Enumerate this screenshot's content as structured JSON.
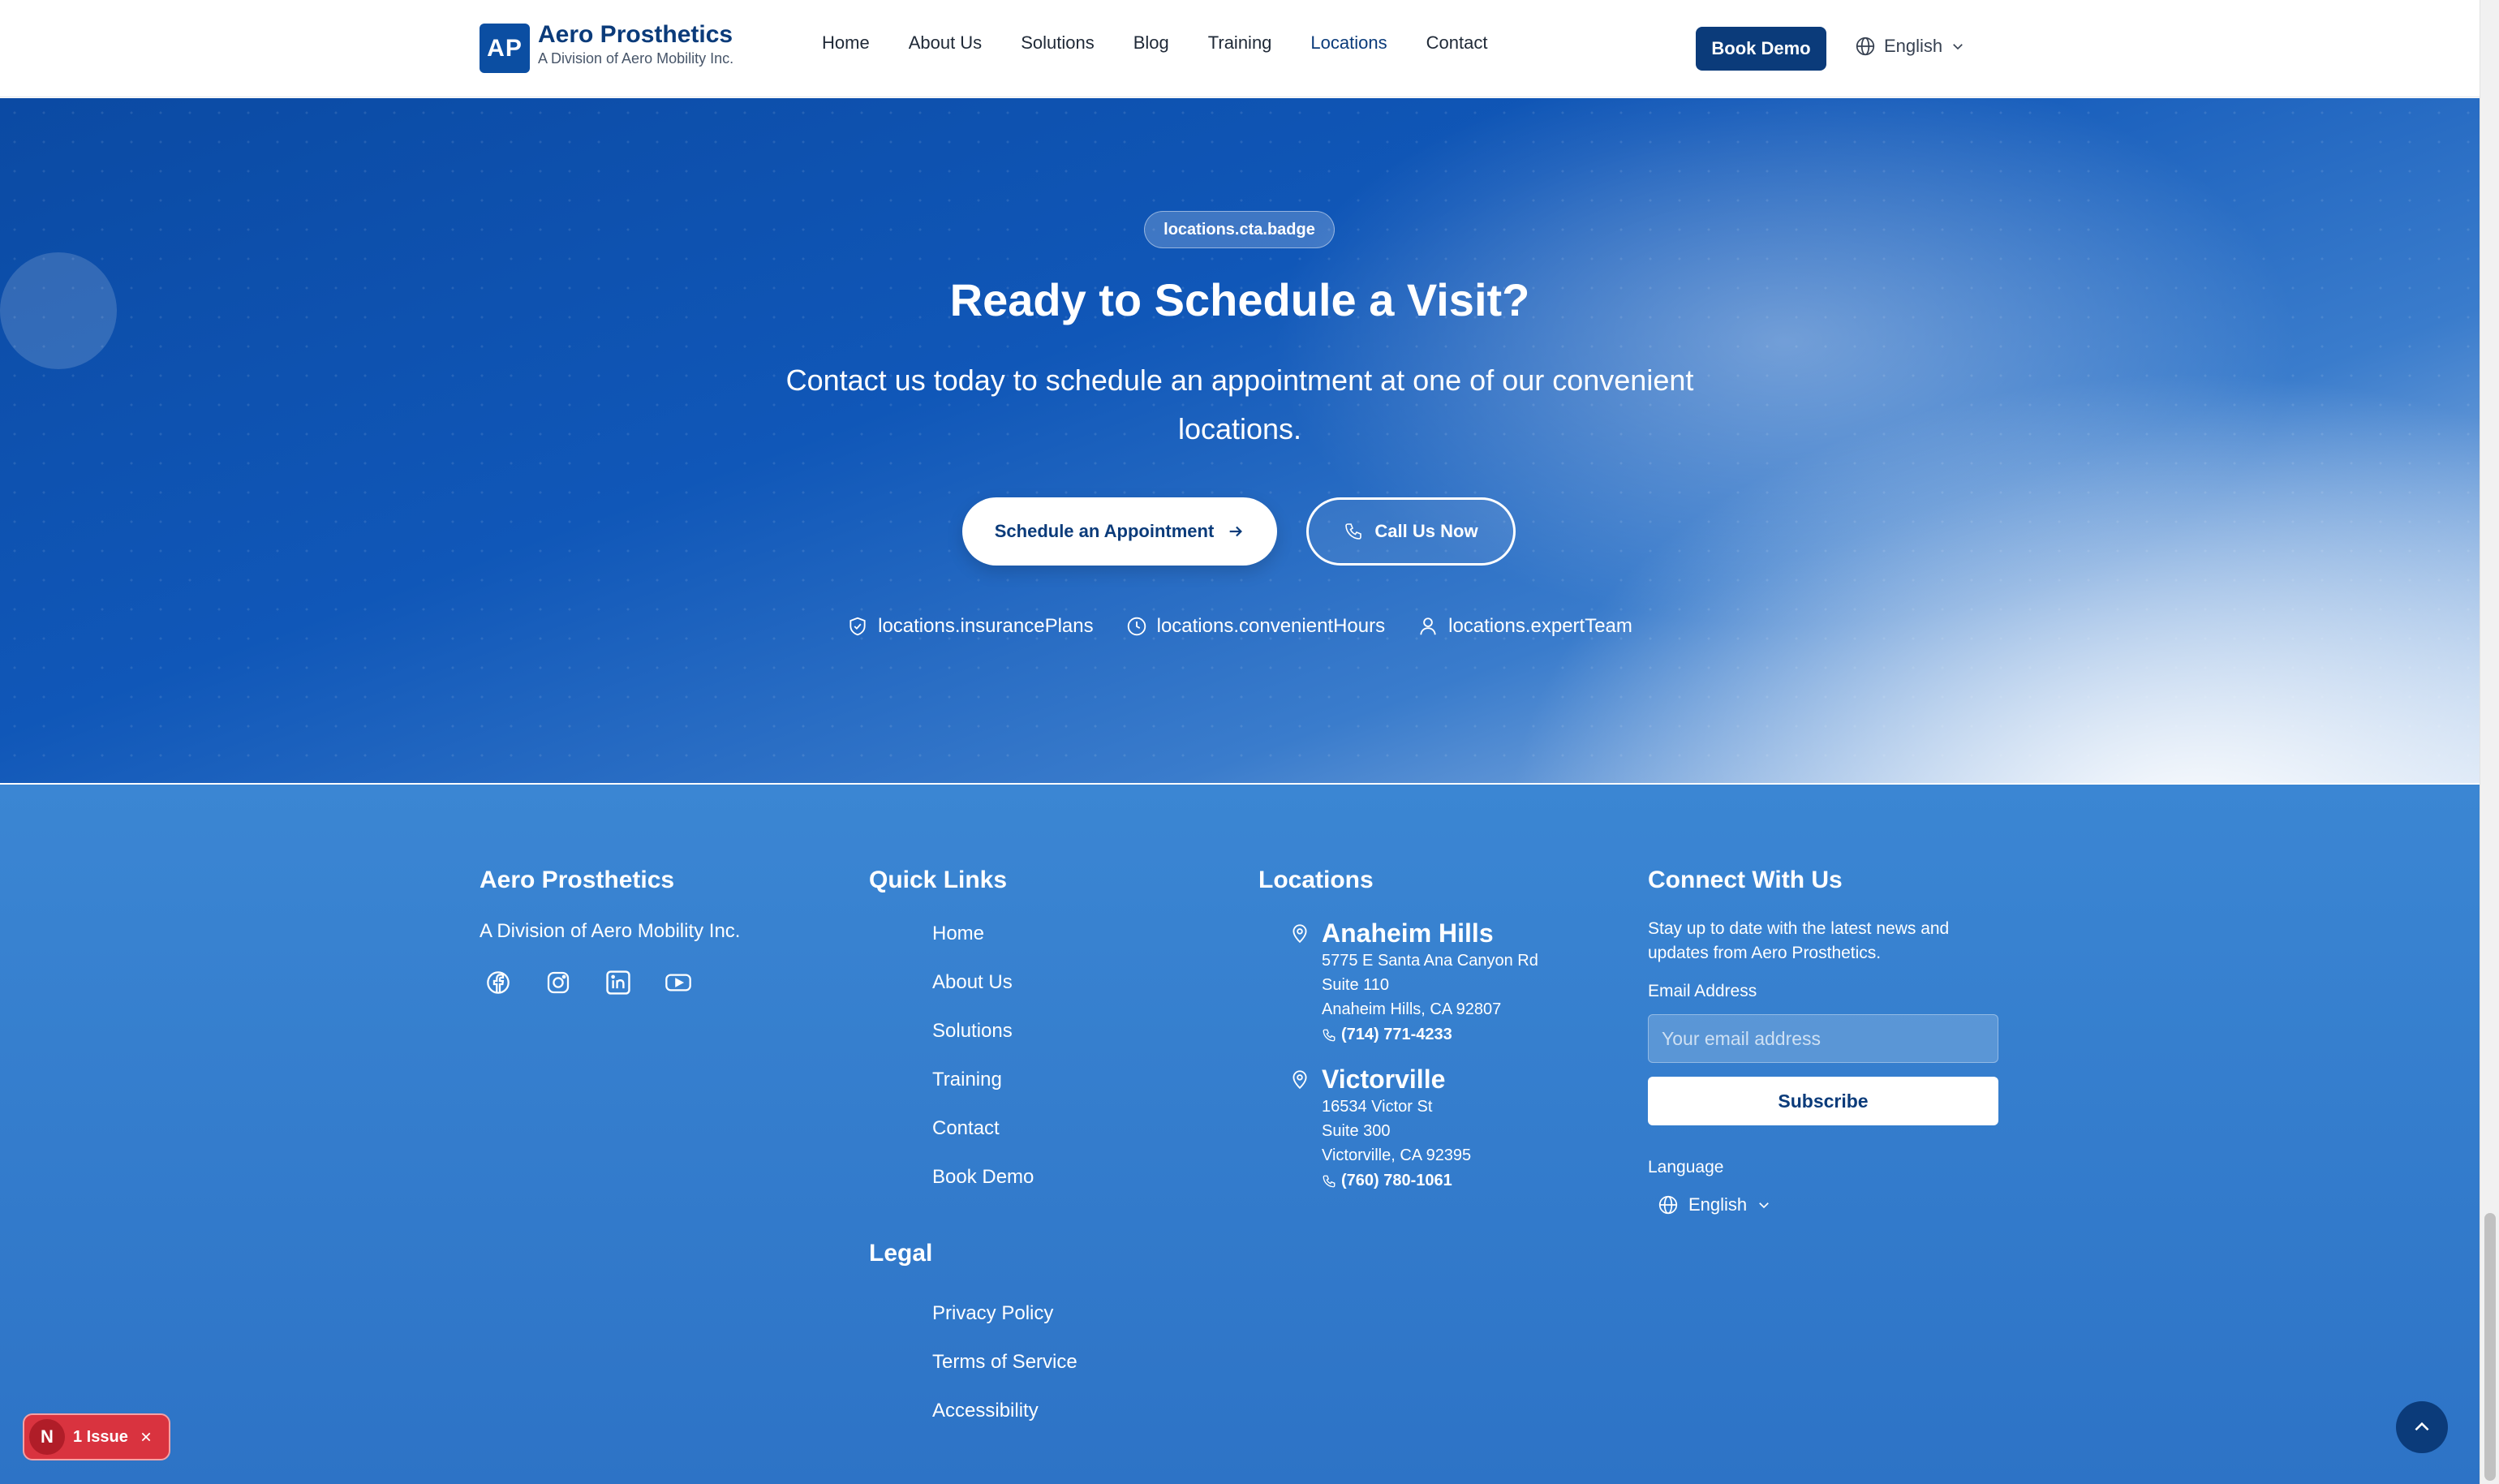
{
  "header": {
    "logo_initials": "AP",
    "brand_name": "Aero Prosthetics",
    "brand_sub": "A Division of Aero Mobility Inc.",
    "nav": [
      {
        "label": "Home"
      },
      {
        "label": "About Us"
      },
      {
        "label": "Solutions"
      },
      {
        "label": "Blog"
      },
      {
        "label": "Training"
      },
      {
        "label": "Locations",
        "active": true
      },
      {
        "label": "Contact"
      }
    ],
    "book_demo": "Book Demo",
    "language": "English"
  },
  "hero": {
    "badge": "locations.cta.badge",
    "title": "Ready to Schedule a Visit?",
    "subtitle": "Contact us today to schedule an appointment at one of our convenient locations.",
    "schedule_button": "Schedule an Appointment",
    "call_button": "Call Us Now",
    "features": [
      {
        "icon": "shield-check-icon",
        "label": "locations.insurancePlans"
      },
      {
        "icon": "clock-icon",
        "label": "locations.convenientHours"
      },
      {
        "icon": "user-icon",
        "label": "locations.expertTeam"
      }
    ]
  },
  "footer": {
    "brand": {
      "title": "Aero Prosthetics",
      "tagline": "A Division of Aero Mobility Inc.",
      "socials": [
        "facebook-icon",
        "instagram-icon",
        "linkedin-icon",
        "youtube-icon"
      ]
    },
    "quick_links": {
      "title": "Quick Links",
      "items": [
        "Home",
        "About Us",
        "Solutions",
        "Training",
        "Contact",
        "Book Demo"
      ]
    },
    "legal": {
      "title": "Legal",
      "items": [
        "Privacy Policy",
        "Terms of Service",
        "Accessibility"
      ]
    },
    "locations": {
      "title": "Locations",
      "items": [
        {
          "name": "Anaheim Hills",
          "line1": "5775 E Santa Ana Canyon Rd",
          "line2": "Suite 110",
          "line3": "Anaheim Hills, CA 92807",
          "phone": "(714) 771-4233"
        },
        {
          "name": "Victorville",
          "line1": "16534 Victor St",
          "line2": "Suite 300",
          "line3": "Victorville, CA 92395",
          "phone": "(760) 780-1061"
        }
      ]
    },
    "connect": {
      "title": "Connect With Us",
      "text": "Stay up to date with the latest news and updates from Aero Prosthetics.",
      "email_label": "Email Address",
      "email_placeholder": "Your email address",
      "subscribe": "Subscribe",
      "language_label": "Language",
      "language": "English"
    }
  },
  "dev_overlay": {
    "initial": "N",
    "issues": "1 Issue"
  },
  "colors": {
    "brand_navy": "#0b3b7a",
    "hero_blue": "#0b4aa3",
    "footer_blue": "#3b86d3",
    "issue_red": "#d9333f"
  }
}
